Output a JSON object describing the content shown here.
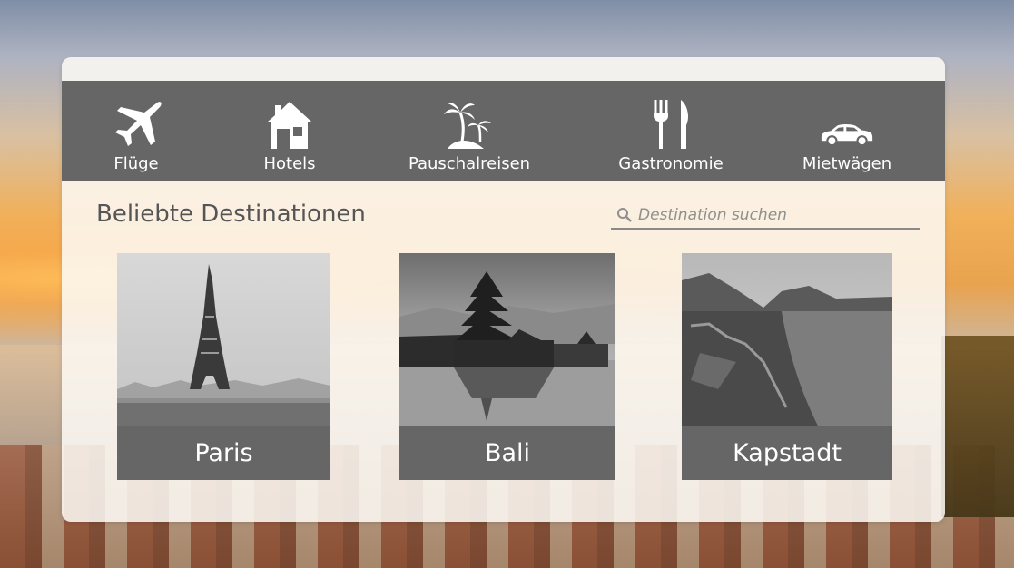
{
  "nav": {
    "items": [
      {
        "label": "Flüge",
        "icon": "airplane-icon"
      },
      {
        "label": "Hotels",
        "icon": "house-icon"
      },
      {
        "label": "Pauschalreisen",
        "icon": "palm-island-icon"
      },
      {
        "label": "Gastronomie",
        "icon": "fork-knife-icon"
      },
      {
        "label": "Mietwägen",
        "icon": "car-icon"
      }
    ]
  },
  "main": {
    "title": "Beliebte Destinationen",
    "search": {
      "placeholder": "Destination suchen",
      "value": "",
      "icon": "search-icon"
    },
    "destinations": [
      {
        "name": "Paris",
        "image": "eiffel-tower-photo"
      },
      {
        "name": "Bali",
        "image": "bali-temple-photo"
      },
      {
        "name": "Kapstadt",
        "image": "cape-town-coast-photo"
      }
    ]
  },
  "colors": {
    "navbar": "#666666",
    "panel": "#fdfaf6",
    "text_dark": "#555555",
    "text_light": "#ffffff"
  }
}
